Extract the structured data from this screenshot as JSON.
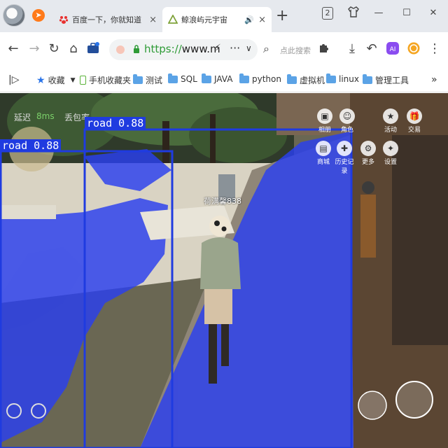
{
  "browser": {
    "tabs": [
      {
        "title": "百度一下，你就知道",
        "active": false
      },
      {
        "title": "鲸浪屿元宇宙",
        "active": true
      }
    ],
    "tab_count_badge": "2",
    "omnibox": {
      "url_scheme": "https://",
      "url_rest": "www.m"
    },
    "search_placeholder": "点此搜索",
    "ai_badge": "AI"
  },
  "bookmarks": [
    {
      "label": "收藏",
      "icon": "star-icon"
    },
    {
      "label": "手机收藏夹",
      "icon": "phone-icon"
    },
    {
      "label": "测试",
      "icon": "folder-icon"
    },
    {
      "label": "SQL",
      "icon": "folder-icon"
    },
    {
      "label": "JAVA",
      "icon": "folder-icon"
    },
    {
      "label": "python",
      "icon": "folder-icon"
    },
    {
      "label": "虚拟机",
      "icon": "folder-icon"
    },
    {
      "label": "linux",
      "icon": "folder-icon"
    },
    {
      "label": "管理工具",
      "icon": "folder-icon"
    }
  ],
  "game": {
    "hud": {
      "latency_label": "延迟",
      "latency_value": "8ms",
      "other_label": "丢包率"
    },
    "player_name": "荷满馨838",
    "detections": [
      {
        "label": "road 0.88"
      },
      {
        "label": "road 0.88"
      }
    ],
    "side_menu": [
      "相册",
      "角色",
      "活动",
      "交易",
      "商城",
      "历史记录",
      "更多",
      "设置"
    ],
    "colors": {
      "mask": "#2a3ff0",
      "bbox": "#1f3be0"
    }
  }
}
